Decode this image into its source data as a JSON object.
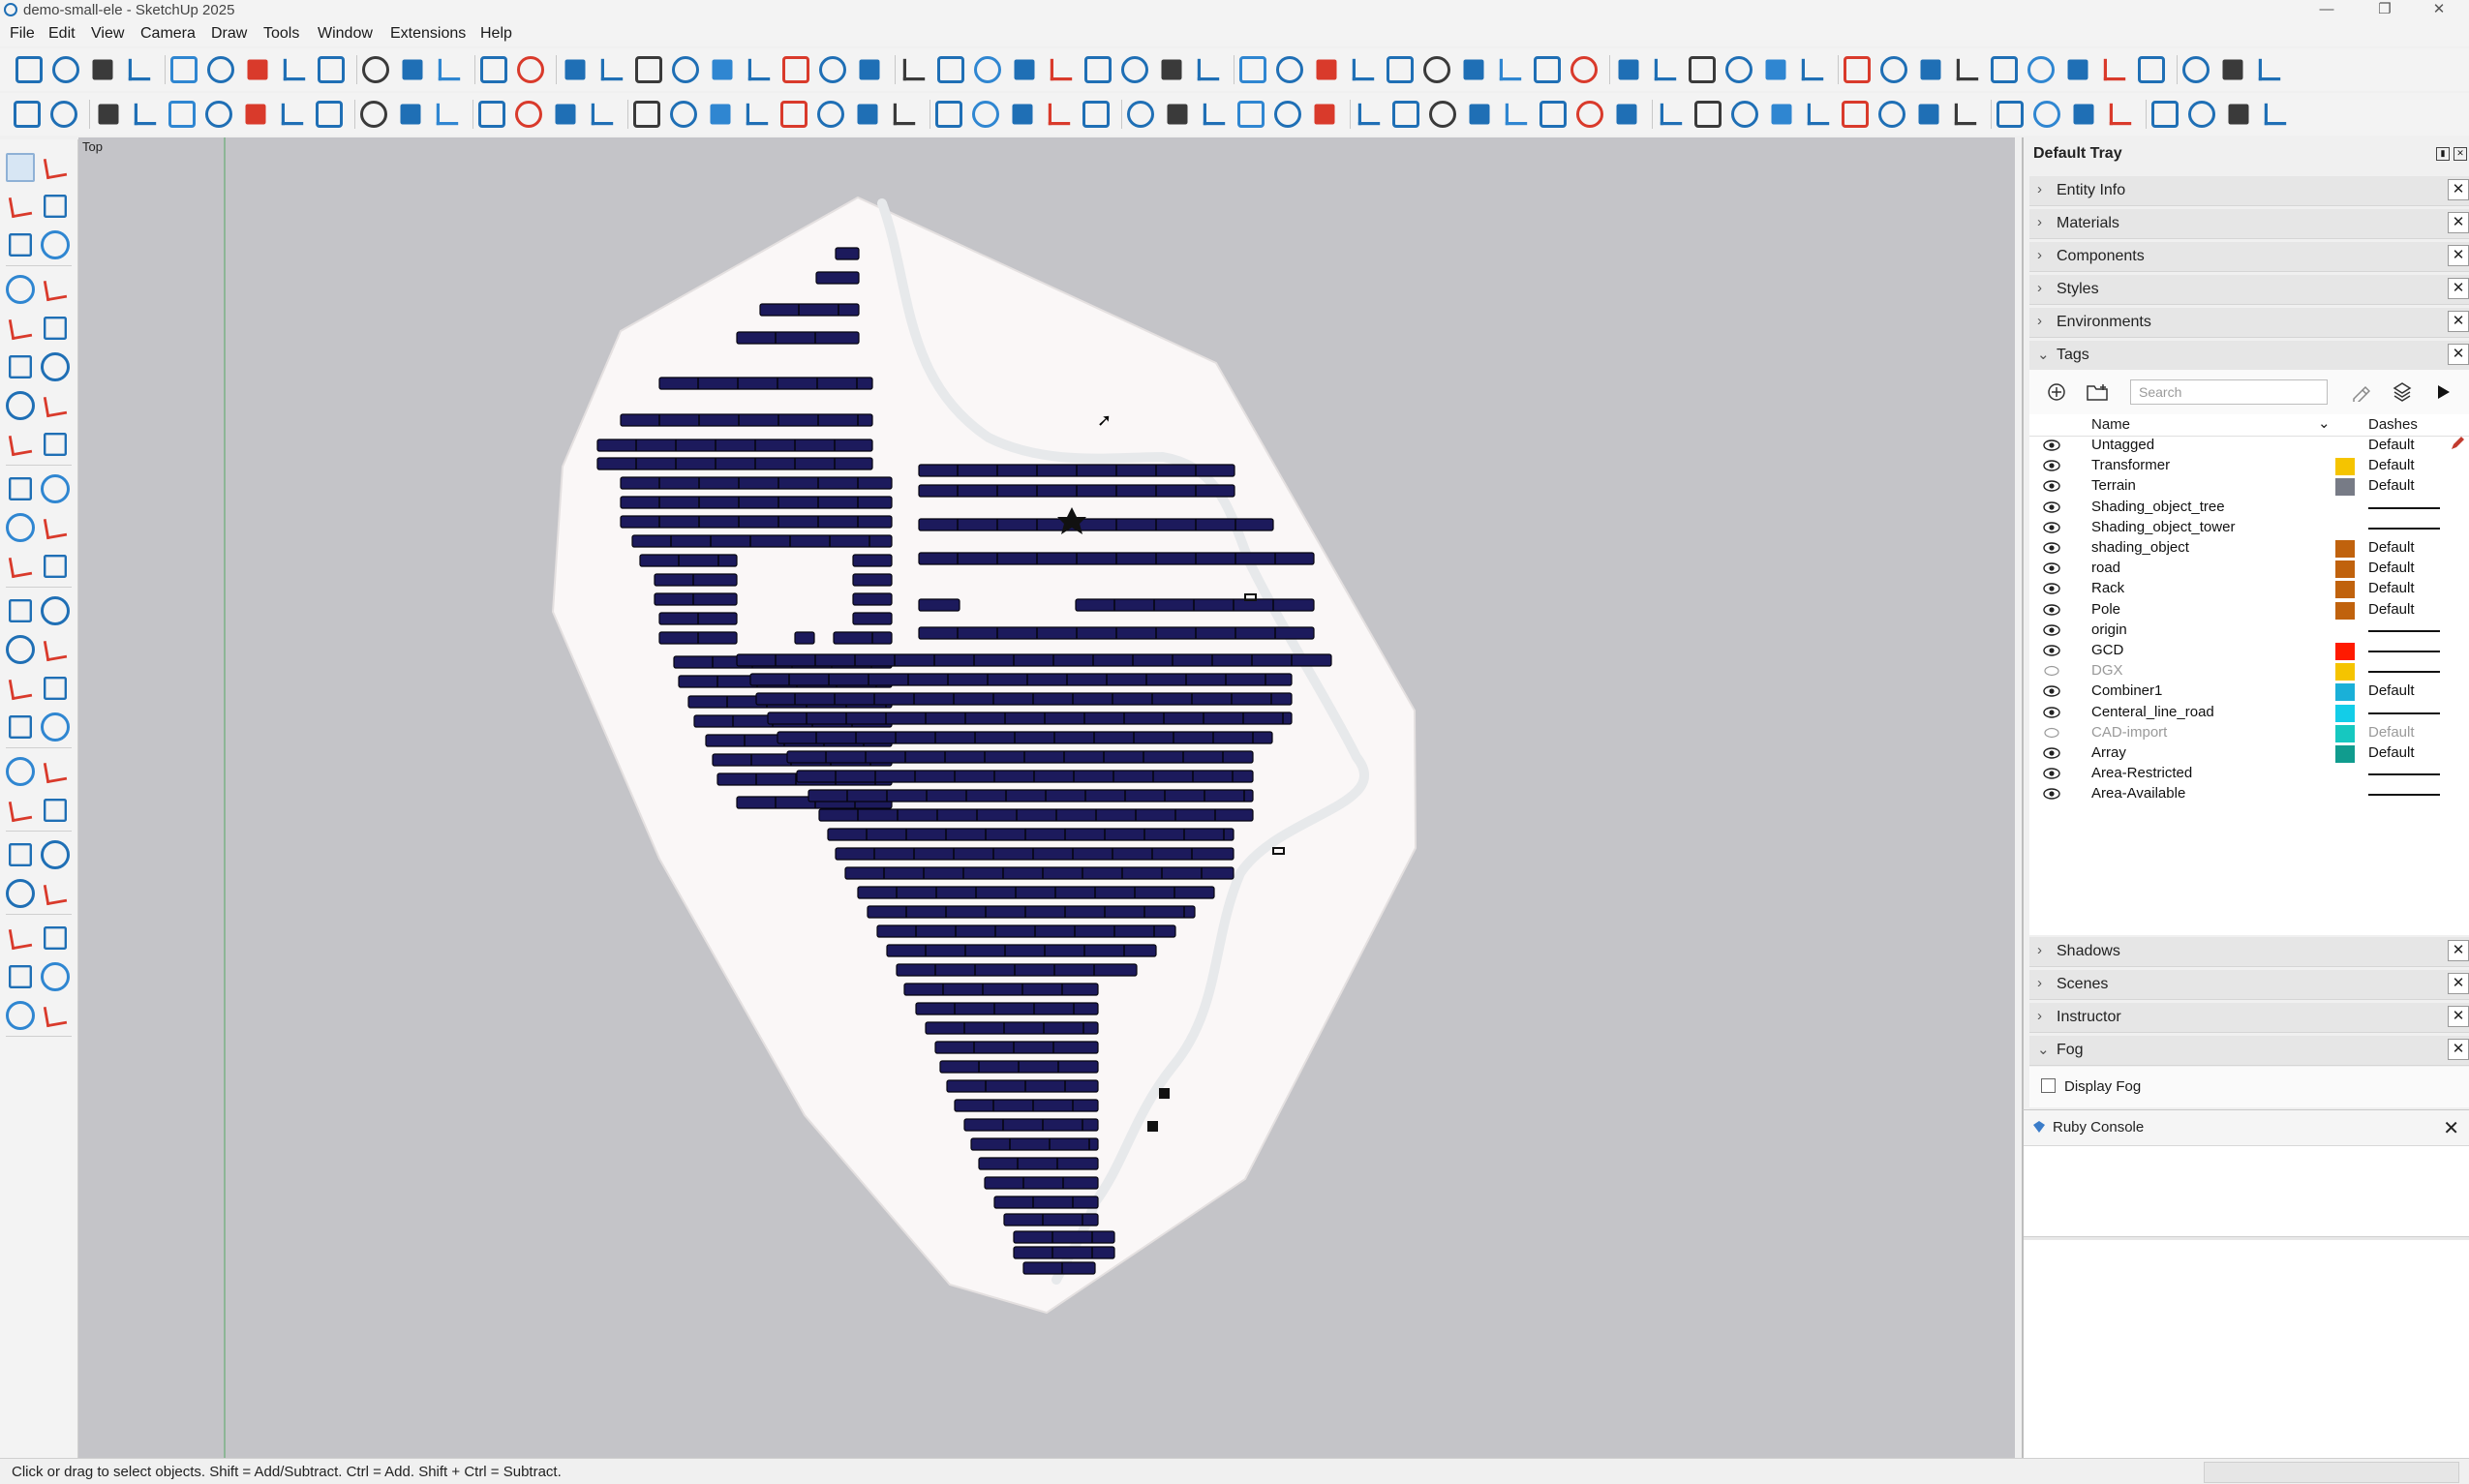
{
  "window": {
    "title": "demo-small-ele - SketchUp 2025"
  },
  "menu": [
    "File",
    "Edit",
    "View",
    "Camera",
    "Draw",
    "Tools",
    "Window",
    "Extensions",
    "Help"
  ],
  "viewport": {
    "view_label": "Top"
  },
  "tray": {
    "title": "Default Tray",
    "panels_top": [
      "Entity Info",
      "Materials",
      "Components",
      "Styles",
      "Environments",
      "Tags"
    ],
    "tags": {
      "search_placeholder": "Search",
      "col_name": "Name",
      "col_dashes": "Dashes",
      "items": [
        {
          "name": "Untagged",
          "visible": true,
          "color": "",
          "dashes": "Default"
        },
        {
          "name": "Transformer",
          "visible": true,
          "color": "#f5c400",
          "dashes": "Default"
        },
        {
          "name": "Terrain",
          "visible": true,
          "color": "#777b86",
          "dashes": "Default"
        },
        {
          "name": "Shading_object_tree",
          "visible": true,
          "color": "",
          "dashes": ""
        },
        {
          "name": "Shading_object_tower",
          "visible": true,
          "color": "",
          "dashes": ""
        },
        {
          "name": "shading_object",
          "visible": true,
          "color": "#c0620d",
          "dashes": "Default"
        },
        {
          "name": "road",
          "visible": true,
          "color": "#c0620d",
          "dashes": "Default"
        },
        {
          "name": "Rack",
          "visible": true,
          "color": "#c0620d",
          "dashes": "Default"
        },
        {
          "name": "Pole",
          "visible": true,
          "color": "#c0620d",
          "dashes": "Default"
        },
        {
          "name": "origin",
          "visible": true,
          "color": "",
          "dashes": ""
        },
        {
          "name": "GCD",
          "visible": true,
          "color": "#ff1a00",
          "dashes": ""
        },
        {
          "name": "DGX",
          "visible": false,
          "color": "#f5c400",
          "dashes": ""
        },
        {
          "name": "Combiner1",
          "visible": true,
          "color": "#1ab0d8",
          "dashes": "Default"
        },
        {
          "name": "Centeral_line_road",
          "visible": true,
          "color": "#13cde8",
          "dashes": ""
        },
        {
          "name": "CAD-import",
          "visible": false,
          "color": "#16c8c0",
          "dashes": "Default"
        },
        {
          "name": "Array",
          "visible": true,
          "color": "#109c8e",
          "dashes": "Default"
        },
        {
          "name": "Area-Restricted",
          "visible": true,
          "color": "",
          "dashes": ""
        },
        {
          "name": "Area-Available",
          "visible": true,
          "color": "",
          "dashes": ""
        }
      ]
    },
    "panels_bottom": [
      "Shadows",
      "Scenes",
      "Instructor",
      "Fog"
    ],
    "fog": {
      "display_fog_label": "Display Fog",
      "display_fog_checked": false
    }
  },
  "ruby_console": {
    "title": "Ruby Console"
  },
  "status": {
    "text": "Click or drag to select objects. Shift = Add/Subtract. Ctrl = Add. Shift + Ctrl = Subtract."
  },
  "colors": {
    "accent": "#1f6fb5",
    "panel_array": "#1c1a5c",
    "viewport_bg": "#c4c4c8",
    "terrain": "#faf7f7"
  }
}
